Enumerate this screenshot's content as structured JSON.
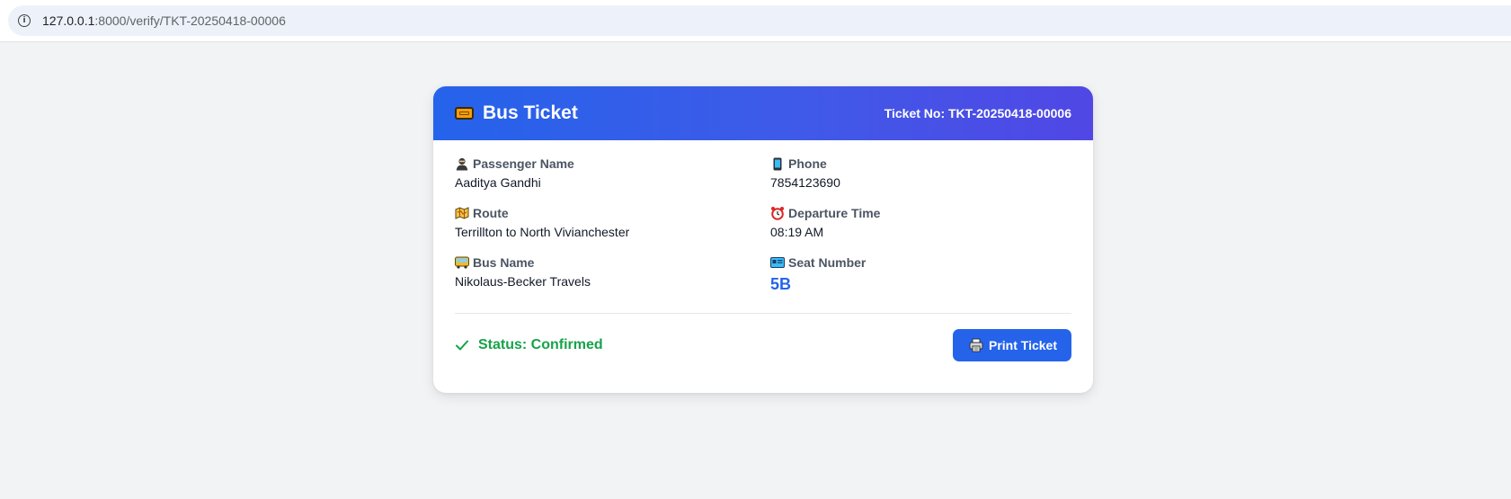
{
  "browser": {
    "url_host": "127.0.0.1",
    "url_path": ":8000/verify/TKT-20250418-00006",
    "info_icon": "info-icon"
  },
  "ticket": {
    "title": "Bus Ticket",
    "title_icon": "ticket-icon",
    "ticket_no_text": "Ticket No: TKT-20250418-00006",
    "fields": {
      "passenger_name": {
        "label": "Passenger Name",
        "value": "Aaditya Gandhi",
        "icon": "person-icon"
      },
      "phone": {
        "label": "Phone",
        "value": "7854123690",
        "icon": "mobile-phone-icon"
      },
      "route": {
        "label": "Route",
        "value": "Terrillton to North Vivianchester",
        "icon": "map-icon"
      },
      "departure_time": {
        "label": "Departure Time",
        "value": "08:19 AM",
        "icon": "alarm-clock-icon"
      },
      "bus_name": {
        "label": "Bus Name",
        "value": "Nikolaus-Becker Travels",
        "icon": "bus-icon"
      },
      "seat_number": {
        "label": "Seat Number",
        "value": "5B",
        "icon": "ticket-card-icon"
      }
    },
    "status_text": "Status: Confirmed",
    "print_label": "Print Ticket"
  },
  "colors": {
    "header_gradient_start": "#2563eb",
    "header_gradient_end": "#5047e5",
    "status_green": "#16a34a",
    "seat_blue": "#2563eb",
    "button_blue": "#2563eb",
    "page_background": "#f2f3f5"
  }
}
